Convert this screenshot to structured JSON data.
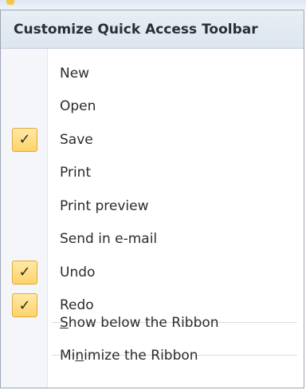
{
  "menu": {
    "title": "Customize Quick Access Toolbar",
    "items": [
      {
        "label": "New",
        "checked": false
      },
      {
        "label": "Open",
        "checked": false
      },
      {
        "label": "Save",
        "checked": true
      },
      {
        "label": "Print",
        "checked": false
      },
      {
        "label": "Print preview",
        "checked": false
      },
      {
        "label": "Send in e-mail",
        "checked": false
      },
      {
        "label": "Undo",
        "checked": true
      },
      {
        "label": "Redo",
        "checked": true
      }
    ],
    "show_below_prefix": "S",
    "show_below_rest": "how below the Ribbon",
    "minimize_prefix": "Mi",
    "minimize_access": "n",
    "minimize_rest": "imize the Ribbon",
    "check_glyph": "✓"
  },
  "colors": {
    "check_fill": "#ffd36a",
    "check_border": "#e0a93a",
    "header_bg": "#dde5ef"
  }
}
